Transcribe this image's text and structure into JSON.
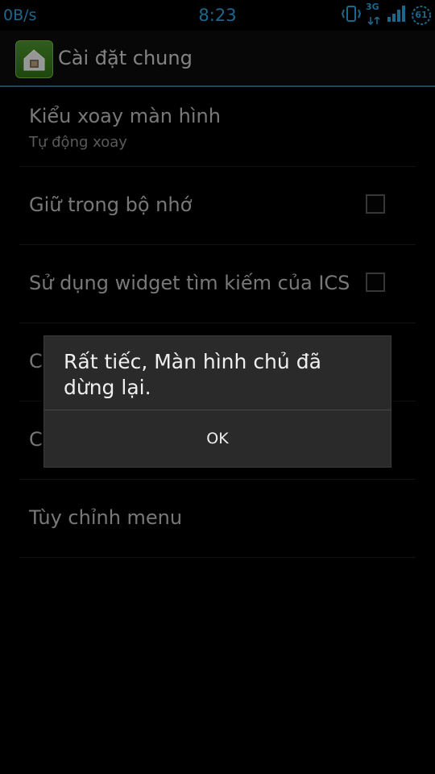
{
  "status_bar": {
    "speed": "0B/s",
    "time": "8:23",
    "network": "3G",
    "battery": "61",
    "icons": [
      "vibrate-icon",
      "network-3g-icon",
      "signal-icon",
      "battery-icon"
    ],
    "accent_color": "#2d9fd8"
  },
  "action_bar": {
    "title": "Cài đặt chung",
    "icon": "app-launcher-icon"
  },
  "preferences": [
    {
      "title": "Kiểu xoay màn hình",
      "summary": "Tự động xoay",
      "checkbox": false
    },
    {
      "title": "Giữ trong bộ nhớ",
      "checkbox": true,
      "checked": false
    },
    {
      "title": "Sử dụng widget tìm kiếm của ICS",
      "checkbox": true,
      "checked": false
    },
    {
      "title": "C"
    },
    {
      "title": "C"
    },
    {
      "title": "Tùy chỉnh menu"
    }
  ],
  "dialog": {
    "message": "Rất tiếc, Màn hình chủ đã dừng lại.",
    "ok_label": "OK"
  }
}
